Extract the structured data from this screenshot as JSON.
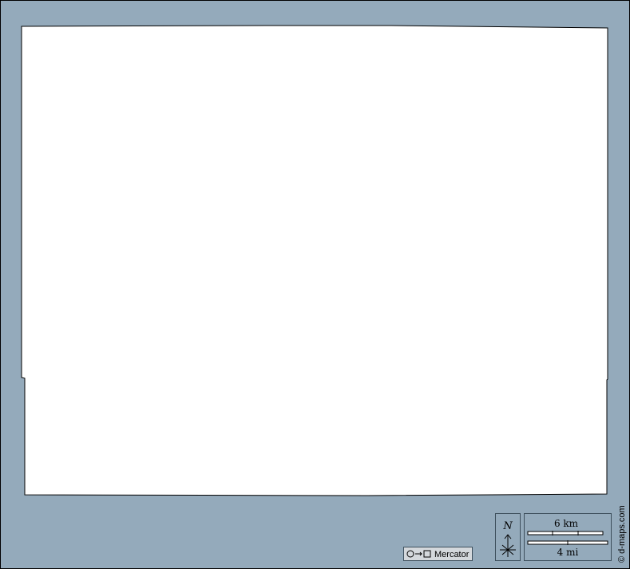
{
  "map": {
    "water_color": "#94aabb",
    "land_color": "#ffffff",
    "border_color": "#000000"
  },
  "north_arrow": {
    "label": "N"
  },
  "scale_bar": {
    "km_label": "6 km",
    "mi_label": "4 mi"
  },
  "projection": {
    "icon": "circle-to-square-icon",
    "label": "Mercator"
  },
  "credit": {
    "text": "© d-maps.com"
  }
}
